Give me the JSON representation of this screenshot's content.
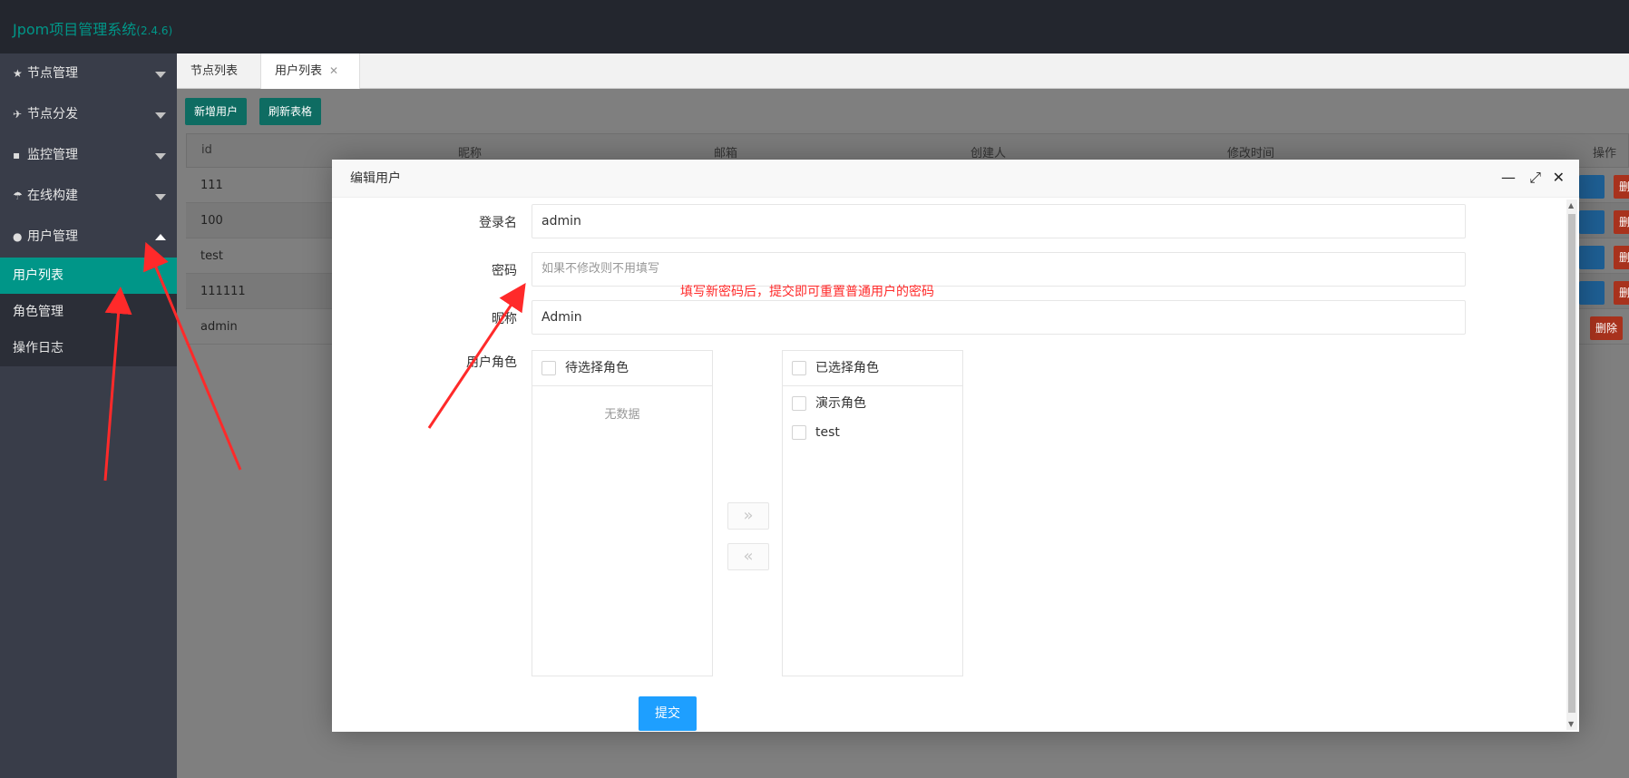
{
  "header": {
    "logo": "Jpom项目管理系统",
    "version": "(2.4.6)"
  },
  "sidebar": {
    "items": [
      {
        "label": "节点管理",
        "icon": "star-icon"
      },
      {
        "label": "节点分发",
        "icon": "send-icon"
      },
      {
        "label": "监控管理",
        "icon": "chat-icon"
      },
      {
        "label": "在线构建",
        "icon": "umbrella-icon"
      },
      {
        "label": "用户管理",
        "icon": "user-icon"
      }
    ],
    "sub_items": [
      "用户列表",
      "角色管理",
      "操作日志"
    ]
  },
  "tabs": [
    "节点列表",
    "用户列表"
  ],
  "toolbar": {
    "add_user": "新增用户",
    "refresh": "刷新表格"
  },
  "table": {
    "headers": [
      "id",
      "昵称",
      "邮箱",
      "创建人",
      "修改时间",
      "操作"
    ],
    "rows": [
      "111",
      "100",
      "test",
      "111111",
      "admin"
    ],
    "delete_label": "删除"
  },
  "modal": {
    "title": "编辑用户",
    "login_label": "登录名",
    "login_value": "admin",
    "password_label": "密码",
    "password_placeholder": "如果不修改则不用填写",
    "nickname_label": "昵称",
    "nickname_value": "Admin",
    "role_label": "用户角色",
    "left_title": "待选择角色",
    "left_empty": "无数据",
    "right_title": "已选择角色",
    "right_items": [
      "演示角色",
      "test"
    ],
    "submit": "提交"
  },
  "annotation": "填写新密码后，提交即可重置普通用户的密码",
  "colors": {
    "accent": "#009688",
    "submit": "#1e9fff",
    "annotation": "#ff2a2a"
  }
}
